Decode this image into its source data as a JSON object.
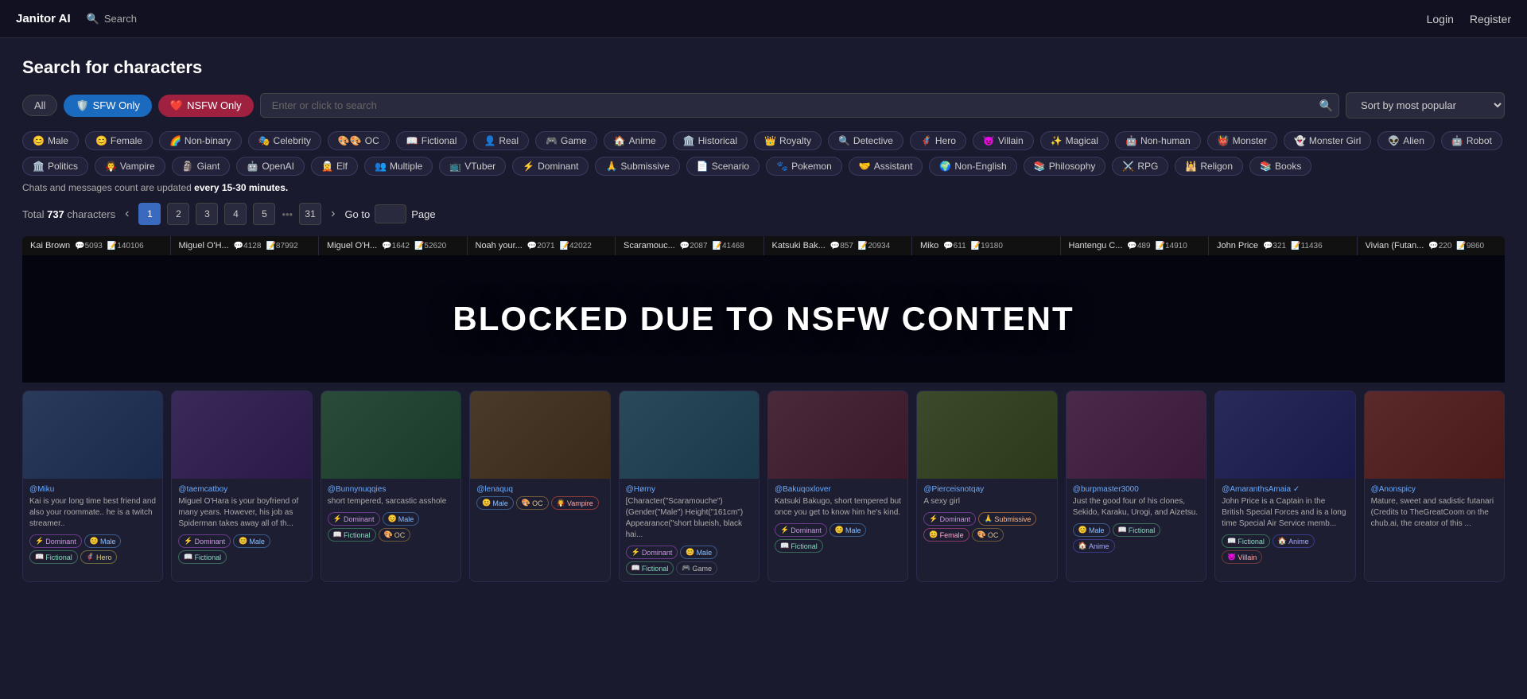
{
  "header": {
    "logo": "Janitor AI",
    "search_label": "Search",
    "login": "Login",
    "register": "Register"
  },
  "page": {
    "title": "Search for characters",
    "notice": "Chats and messages count are updated",
    "notice_bold": "every 15-30 minutes.",
    "total_label": "Total",
    "total_count": "737",
    "total_suffix": "characters",
    "goto_label": "Go to",
    "page_label": "Page"
  },
  "filters": {
    "all": "All",
    "sfw_only": "SFW Only",
    "nsfw_only": "NSFW Only",
    "search_placeholder": "Enter or click to search",
    "sort_label": "Sort by most popular"
  },
  "tags": [
    {
      "emoji": "😊",
      "label": "Male"
    },
    {
      "emoji": "😊",
      "label": "Female"
    },
    {
      "emoji": "🌈",
      "label": "Non-binary"
    },
    {
      "emoji": "🎭",
      "label": "Celebrity"
    },
    {
      "emoji": "🎨🎨",
      "label": "OC"
    },
    {
      "emoji": "📖",
      "label": "Fictional"
    },
    {
      "emoji": "👤",
      "label": "Real"
    },
    {
      "emoji": "🎮",
      "label": "Game"
    },
    {
      "emoji": "🏠",
      "label": "Anime"
    },
    {
      "emoji": "🏛️",
      "label": "Historical"
    },
    {
      "emoji": "👑",
      "label": "Royalty"
    },
    {
      "emoji": "🔍",
      "label": "Detective"
    },
    {
      "emoji": "🦸",
      "label": "Hero"
    },
    {
      "emoji": "😈",
      "label": "Villain"
    },
    {
      "emoji": "✨",
      "label": "Magical"
    },
    {
      "emoji": "🤖",
      "label": "Non-human"
    },
    {
      "emoji": "👹",
      "label": "Monster"
    },
    {
      "emoji": "👻",
      "label": "Monster Girl"
    },
    {
      "emoji": "👽",
      "label": "Alien"
    },
    {
      "emoji": "🤖",
      "label": "Robot"
    },
    {
      "emoji": "🏛️",
      "label": "Politics"
    },
    {
      "emoji": "🧛",
      "label": "Vampire"
    },
    {
      "emoji": "🗿",
      "label": "Giant"
    },
    {
      "emoji": "🤖",
      "label": "OpenAI"
    },
    {
      "emoji": "🧝",
      "label": "Elf"
    },
    {
      "emoji": "👥",
      "label": "Multiple"
    },
    {
      "emoji": "📺",
      "label": "VTuber"
    },
    {
      "emoji": "⚡",
      "label": "Dominant"
    },
    {
      "emoji": "🙏",
      "label": "Submissive"
    },
    {
      "emoji": "📄",
      "label": "Scenario"
    },
    {
      "emoji": "🐾",
      "label": "Pokemon"
    },
    {
      "emoji": "🤝",
      "label": "Assistant"
    },
    {
      "emoji": "🌍",
      "label": "Non-English"
    },
    {
      "emoji": "📚",
      "label": "Philosophy"
    },
    {
      "emoji": "⚔️",
      "label": "RPG"
    },
    {
      "emoji": "🕌",
      "label": "Religon"
    },
    {
      "emoji": "📚",
      "label": "Books"
    }
  ],
  "pagination": {
    "pages": [
      "1",
      "2",
      "3",
      "4",
      "5",
      "31"
    ],
    "current": "1",
    "prev_arrow": "‹",
    "next_arrow": "›"
  },
  "strip": [
    {
      "name": "Kai Brown",
      "chats": "5093",
      "msgs": "140106"
    },
    {
      "name": "Miguel O'H...",
      "chats": "4128",
      "msgs": "87992"
    },
    {
      "name": "Miguel O'H...",
      "chats": "1642",
      "msgs": "52620"
    },
    {
      "name": "Noah your...",
      "chats": "2071",
      "msgs": "42022"
    },
    {
      "name": "Scaramouc...",
      "chats": "2087",
      "msgs": "41468"
    },
    {
      "name": "Katsuki Bak...",
      "chats": "857",
      "msgs": "20934"
    },
    {
      "name": "Miko",
      "chats": "611",
      "msgs": "19180"
    },
    {
      "name": "Hantengu C...",
      "chats": "489",
      "msgs": "14910"
    },
    {
      "name": "John Price",
      "chats": "321",
      "msgs": "11436"
    },
    {
      "name": "Vivian (Futan...",
      "chats": "220",
      "msgs": "9860"
    }
  ],
  "blocked": {
    "text": "BLOCKED DUE TO NSFW CONTENT"
  },
  "cards": [
    {
      "author": "@Miku",
      "desc": "Kai is your long time best friend and also your roommate.. he is a twitch streamer..",
      "tags": [
        {
          "label": "Dominant",
          "cls": "dominant",
          "emoji": "⚡"
        },
        {
          "label": "Male",
          "cls": "male",
          "emoji": "😊"
        },
        {
          "label": "Fictional",
          "cls": "fictional",
          "emoji": "📖"
        },
        {
          "label": "Hero",
          "cls": "hero",
          "emoji": "🦸"
        }
      ]
    },
    {
      "author": "@taemcatboy",
      "desc": "Miguel O'Hara is your boyfriend of many years. However, his job as Spiderman takes away all of th...",
      "tags": [
        {
          "label": "Dominant",
          "cls": "dominant",
          "emoji": "⚡"
        },
        {
          "label": "Male",
          "cls": "male",
          "emoji": "😊"
        },
        {
          "label": "Fictional",
          "cls": "fictional",
          "emoji": "📖"
        }
      ]
    },
    {
      "author": "@Bunnynuqqies",
      "desc": "short tempered, sarcastic asshole",
      "tags": [
        {
          "label": "Dominant",
          "cls": "dominant",
          "emoji": "⚡"
        },
        {
          "label": "Male",
          "cls": "male",
          "emoji": "😊"
        },
        {
          "label": "Fictional",
          "cls": "fictional",
          "emoji": "📖"
        },
        {
          "label": "OC",
          "cls": "oc",
          "emoji": "🎨"
        }
      ]
    },
    {
      "author": "@lenaquq",
      "desc": "",
      "tags": [
        {
          "label": "Male",
          "cls": "male",
          "emoji": "😊"
        },
        {
          "label": "OC",
          "cls": "oc",
          "emoji": "🎨"
        },
        {
          "label": "Vampire",
          "cls": "vampire",
          "emoji": "🧛"
        }
      ]
    },
    {
      "author": "@Hørny",
      "desc": "[Character(\"Scaramouche\") (Gender(\"Male\") Height(\"161cm\") Appearance(\"short blueish, black hai...",
      "tags": [
        {
          "label": "Dominant",
          "cls": "dominant",
          "emoji": "⚡"
        },
        {
          "label": "Male",
          "cls": "male",
          "emoji": "😊"
        },
        {
          "label": "Fictional",
          "cls": "fictional",
          "emoji": "📖"
        },
        {
          "label": "Game",
          "cls": "",
          "emoji": "🎮"
        }
      ]
    },
    {
      "author": "@Bakuqoxlover",
      "desc": "Katsuki Bakugo, short tempered but once you get to know him he's kind.",
      "tags": [
        {
          "label": "Dominant",
          "cls": "dominant",
          "emoji": "⚡"
        },
        {
          "label": "Male",
          "cls": "male",
          "emoji": "😊"
        },
        {
          "label": "Fictional",
          "cls": "fictional",
          "emoji": "📖"
        }
      ]
    },
    {
      "author": "@Pierceisnotqay",
      "desc": "A sexy girl",
      "tags": [
        {
          "label": "Dominant",
          "cls": "dominant",
          "emoji": "⚡"
        },
        {
          "label": "Submissive",
          "cls": "submissive",
          "emoji": "🙏"
        },
        {
          "label": "Female",
          "cls": "female",
          "emoji": "😊"
        },
        {
          "label": "OC",
          "cls": "oc",
          "emoji": "🎨"
        }
      ]
    },
    {
      "author": "@burpmaster3000",
      "desc": "Just the good four of his clones, Sekido, Karaku, Urogi, and Aizetsu.",
      "tags": [
        {
          "label": "Male",
          "cls": "male",
          "emoji": "😊"
        },
        {
          "label": "Fictional",
          "cls": "fictional",
          "emoji": "📖"
        },
        {
          "label": "Anime",
          "cls": "anime",
          "emoji": "🏠"
        }
      ]
    },
    {
      "author": "@AmaranthsAmaia ✓",
      "desc": "John Price is a Captain in the British Special Forces and is a long time Special Air Service memb...",
      "tags": [
        {
          "label": "Fictional",
          "cls": "fictional",
          "emoji": "📖"
        },
        {
          "label": "Anime",
          "cls": "anime",
          "emoji": "🏠"
        },
        {
          "label": "Villain",
          "cls": "villain",
          "emoji": "😈"
        }
      ]
    },
    {
      "author": "@Anonspicy",
      "desc": "Mature, sweet and sadistic futanari (Credits to TheGreatCoom on the chub.ai, the creator of this ...",
      "tags": []
    }
  ]
}
